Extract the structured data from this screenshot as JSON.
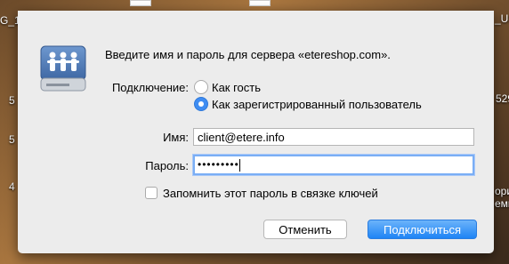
{
  "desktop": {
    "left_labels": [
      "G_1",
      "5",
      "5",
      "4"
    ],
    "right_labels": [
      "_US",
      "529",
      "ори",
      "емы"
    ]
  },
  "dialog": {
    "title": "Введите имя и пароль для сервера «etereshop.com».",
    "connection_label": "Подключение:",
    "options": [
      {
        "label": "Как гость",
        "selected": false
      },
      {
        "label": "Как зарегистрированный пользователь",
        "selected": true
      }
    ],
    "name_label": "Имя:",
    "name_value": "client@etere.info",
    "password_label": "Пароль:",
    "password_value": "•••••••••",
    "remember_label": "Запомнить этот пароль в связке ключей",
    "remember_checked": false,
    "cancel_button": "Отменить",
    "connect_button": "Подключиться"
  },
  "colors": {
    "accent": "#1e84f5",
    "dialog_bg": "#ececec",
    "icon_blue": "#4f7bb5"
  },
  "icons": [
    "server-users-icon",
    "radio-icon",
    "checkbox-icon"
  ]
}
